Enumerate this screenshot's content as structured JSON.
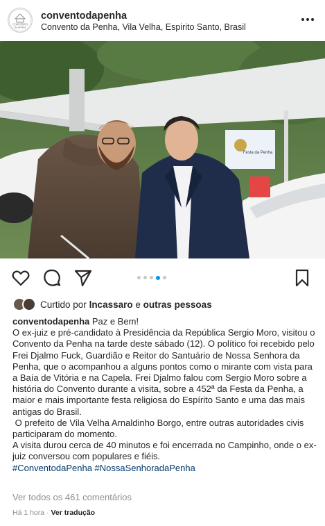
{
  "post": {
    "username": "conventodapenha",
    "location": "Convento da Penha, Vila Velha, Espirito Santo, Brasil",
    "avatar_text_1": "CONVENTO",
    "avatar_text_2": "DA PENHA"
  },
  "photo": {
    "banner_text": "Festa da Penha"
  },
  "carousel": {
    "count": 5,
    "active_index": 3
  },
  "likes": {
    "prefix": "Curtido por",
    "user": "lncassaro",
    "conjunction": "e",
    "others": "outras pessoas"
  },
  "caption": {
    "username": "conventodapenha",
    "greeting": "Paz e Bem!",
    "paragraph1": "O ex-juiz e pré-candidato à Presidência da República Sergio Moro, visitou o Convento da Penha na tarde deste sábado (12). O político foi recebido pelo Frei Djalmo Fuck, Guardião e Reitor do Santuário de Nossa Senhora da Penha, que o acompanhou a alguns pontos como o mirante com vista para a Baía de Vitória e na Capela. Frei Djalmo falou com Sergio Moro sobre a história do Convento durante a visita, sobre a 452ª da Festa da Penha, a maior e mais importante festa religiosa do Espírito Santo e uma das mais antigas do Brasil.",
    "paragraph2": " O prefeito de Vila Velha Arnaldinho Borgo, entre outras autoridades civis participaram do momento.",
    "paragraph3": "A visita durou cerca de 40 minutos e foi encerrada no Campinho, onde o ex-juiz conversou com populares e fiéis.",
    "hashtags": "#ConventodaPenha #NossaSenhoradaPenha"
  },
  "comments": {
    "view_all": "Ver todos os 461 comentários"
  },
  "footer": {
    "time": "Há 1 hora",
    "separator": "·",
    "translate": "Ver tradução"
  }
}
